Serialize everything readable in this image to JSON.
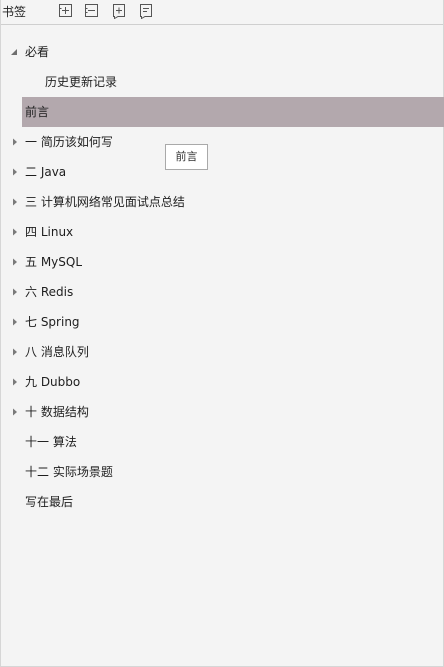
{
  "header": {
    "title": "书签",
    "icons": [
      "expand-all-icon",
      "collapse-all-icon",
      "add-bookmark-icon",
      "bookmark-properties-icon"
    ]
  },
  "tree": {
    "items": [
      {
        "label": "必看",
        "expander": "expanded"
      },
      {
        "label": "历史更新记录",
        "expander": "none"
      },
      {
        "label": "前言",
        "expander": "none",
        "selected": true
      },
      {
        "label": "一 简历该如何写",
        "expander": "collapsed"
      },
      {
        "label": "二 Java",
        "expander": "collapsed"
      },
      {
        "label": "三  计算机网络常见面试点总结",
        "expander": "collapsed"
      },
      {
        "label": "四 Linux",
        "expander": "collapsed"
      },
      {
        "label": "五 MySQL",
        "expander": "collapsed"
      },
      {
        "label": "六 Redis",
        "expander": "collapsed"
      },
      {
        "label": "七 Spring",
        "expander": "collapsed"
      },
      {
        "label": "八 消息队列",
        "expander": "collapsed"
      },
      {
        "label": "九 Dubbo",
        "expander": "collapsed"
      },
      {
        "label": "十 数据结构",
        "expander": "collapsed"
      },
      {
        "label": "十一 算法",
        "expander": "none"
      },
      {
        "label": "十二 实际场景题",
        "expander": "none"
      },
      {
        "label": "写在最后",
        "expander": "none"
      }
    ]
  },
  "tooltip": {
    "text": "前言"
  },
  "colors": {
    "background": "#f4f4f4",
    "selected_row": "#b3a8ad",
    "text": "#1e1e1e",
    "arrow": "#7a7a7a"
  }
}
